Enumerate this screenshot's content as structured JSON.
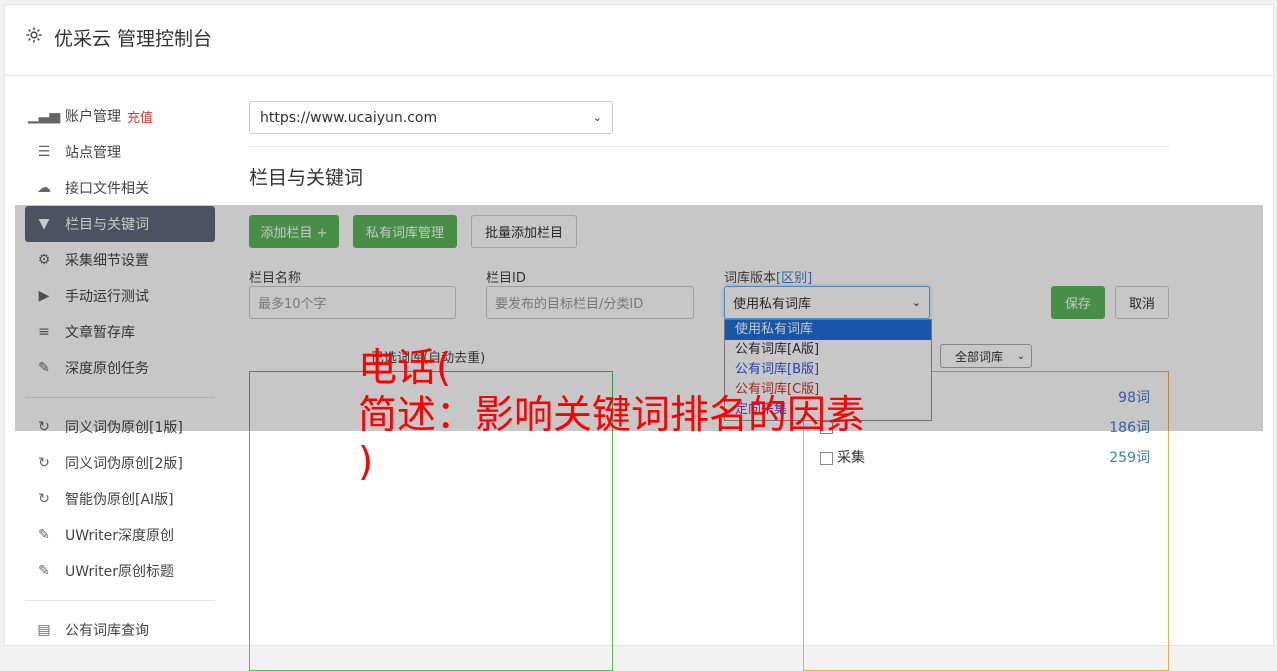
{
  "header": {
    "title": "优采云 管理控制台"
  },
  "sidebar": {
    "items": [
      {
        "label": "账户管理",
        "badge": "充值",
        "icon": "bar-chart-icon"
      },
      {
        "label": "站点管理",
        "icon": "server-icon"
      },
      {
        "label": "接口文件相关",
        "icon": "cloud-upload-icon"
      },
      {
        "label": "栏目与关键词",
        "icon": "filter-icon",
        "active": true
      },
      {
        "label": "采集细节设置",
        "icon": "cogs-icon"
      },
      {
        "label": "手动运行测试",
        "icon": "play-circle-icon"
      },
      {
        "label": "文章暂存库",
        "icon": "database-icon"
      },
      {
        "label": "深度原创任务",
        "icon": "edit-icon"
      }
    ],
    "items2": [
      {
        "label": "同义词伪原创[1版]",
        "icon": "refresh-icon"
      },
      {
        "label": "同义词伪原创[2版]",
        "icon": "refresh-icon"
      },
      {
        "label": "智能伪原创[AI版]",
        "icon": "refresh-icon"
      },
      {
        "label": "UWriter深度原创",
        "icon": "edit-icon"
      },
      {
        "label": "UWriter原创标题",
        "icon": "edit-icon"
      }
    ],
    "items3": [
      {
        "label": "公有词库查询",
        "icon": "book-icon"
      }
    ]
  },
  "main": {
    "site_select": "https://www.ucaiyun.com",
    "section_title": "栏目与关键词",
    "buttons": {
      "add_column": "添加栏目 +",
      "private_lib": "私有词库管理",
      "batch_add": "批量添加栏目",
      "save": "保存",
      "cancel": "取消"
    },
    "form": {
      "name_label": "栏目名称",
      "name_placeholder": "最多10个字",
      "id_label": "栏目ID",
      "id_placeholder": "要发布的目标栏目/分类ID",
      "version_label": "词库版本",
      "version_diff": "[区别]",
      "version_value": "使用私有词库"
    },
    "version_options": [
      "使用私有词库",
      "公有词库[A版]",
      "公有词库[B版]",
      "公有词库[C版]",
      "定向采集"
    ],
    "selected_label": "已选词库(自动去重)",
    "lib_filter": "全部词库",
    "libs": [
      {
        "name": "",
        "count": "98词"
      },
      {
        "name": "",
        "count": "186词"
      },
      {
        "name": "采集",
        "count": "259词"
      }
    ]
  },
  "overlay": {
    "text": "电话(\n简述：影响关键词排名的因素\n)"
  },
  "colors": {
    "green": "#5cb85c",
    "orange": "#f0ad4e",
    "active": "#5f6b7a",
    "red": "#ff0000"
  }
}
